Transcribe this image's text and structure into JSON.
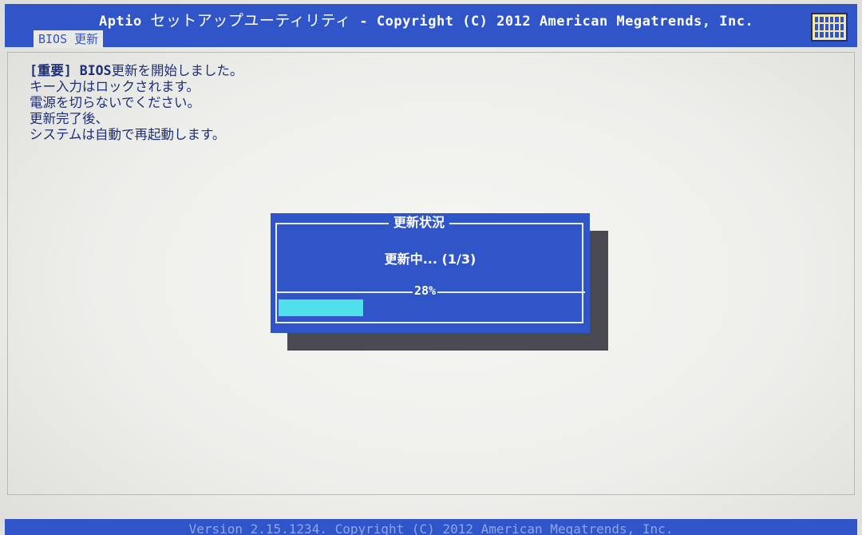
{
  "header": {
    "title_prefix": "Aptio ",
    "title_jp": "セットアップユーティリティ",
    "title_suffix": " - Copyright (C) 2012 American Megatrends, Inc.",
    "active_tab": "BIOS 更新"
  },
  "messages": {
    "line1_strong": "[重要] BIOS",
    "line1_rest": "更新を開始しました。",
    "line2": "キー入力はロックされます。",
    "line3": "電源を切らないでください。",
    "line4": "更新完了後、",
    "line5": "システムは自動で再起動します。"
  },
  "dialog": {
    "title": "更新状況",
    "status": "更新中... (1/3)",
    "percent_label": "28%",
    "progress": 0.28
  },
  "footer": {
    "text": "Version 2.15.1234. Copyright (C) 2012 American Megatrends, Inc."
  },
  "icons": {
    "keyboard": "keyboard-icon"
  },
  "colors": {
    "accent_blue": "#2f55c8",
    "progress_cyan": "#4fe0ec",
    "text_navy": "#1e2f78"
  }
}
